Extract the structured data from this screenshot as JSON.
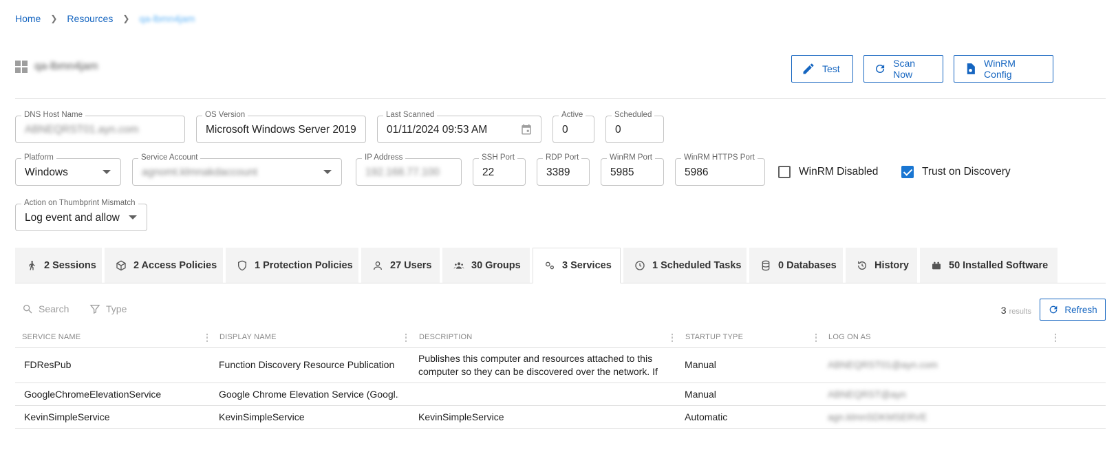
{
  "breadcrumb": {
    "home": "Home",
    "resources": "Resources",
    "current": "qa-lbmn4jam"
  },
  "header": {
    "title": "qa-lbmn4jam",
    "buttons": {
      "test": "Test",
      "scan_now": "Scan Now",
      "winrm_config": "WinRM Config"
    }
  },
  "fields": {
    "dns_host_name": {
      "label": "DNS Host Name",
      "value": "ABNEQRST01.ayn.com"
    },
    "os_version": {
      "label": "OS Version",
      "value": "Microsoft Windows Server 2019"
    },
    "last_scanned": {
      "label": "Last Scanned",
      "value": "01/11/2024 09:53 AM"
    },
    "active": {
      "label": "Active",
      "value": "0"
    },
    "scheduled": {
      "label": "Scheduled",
      "value": "0"
    },
    "platform": {
      "label": "Platform",
      "value": "Windows"
    },
    "service_account": {
      "label": "Service Account",
      "value": "agnomt.klmnakdaccount"
    },
    "ip_address": {
      "label": "IP Address",
      "value": "192.168.77.100"
    },
    "ssh_port": {
      "label": "SSH Port",
      "value": "22"
    },
    "rdp_port": {
      "label": "RDP Port",
      "value": "3389"
    },
    "winrm_port": {
      "label": "WinRM Port",
      "value": "5985"
    },
    "winrm_https_port": {
      "label": "WinRM HTTPS Port",
      "value": "5986"
    },
    "thumbprint_action": {
      "label": "Action on Thumbprint Mismatch",
      "value": "Log event and allow"
    }
  },
  "checkboxes": {
    "winrm_disabled": {
      "label": "WinRM Disabled",
      "checked": false
    },
    "trust_on_discovery": {
      "label": "Trust on Discovery",
      "checked": true
    }
  },
  "tabs": [
    {
      "label": "2 Sessions",
      "icon": "walking-person-icon"
    },
    {
      "label": "2 Access Policies",
      "icon": "cube-icon"
    },
    {
      "label": "1 Protection Policies",
      "icon": "shield-icon"
    },
    {
      "label": "27 Users",
      "icon": "user-icon"
    },
    {
      "label": "30 Groups",
      "icon": "group-icon"
    },
    {
      "label": "3 Services",
      "icon": "gears-icon",
      "active": true
    },
    {
      "label": "1 Scheduled Tasks",
      "icon": "clock-icon"
    },
    {
      "label": "0 Databases",
      "icon": "database-icon"
    },
    {
      "label": "History",
      "icon": "history-icon"
    },
    {
      "label": "50 Installed Software",
      "icon": "software-icon"
    }
  ],
  "toolbar": {
    "search": "Search",
    "type": "Type",
    "results_count": "3",
    "results_label": "results",
    "refresh": "Refresh"
  },
  "table": {
    "columns": [
      "SERVICE NAME",
      "DISPLAY NAME",
      "DESCRIPTION",
      "STARTUP TYPE",
      "LOG ON AS"
    ],
    "rows": [
      {
        "service_name": "FDResPub",
        "display_name": "Function Discovery Resource Publication",
        "description": "Publishes this computer and resources attached to this computer so they can be discovered over the network.  If ...",
        "startup_type": "Manual",
        "log_on_as": "ABNEQRST01@ayn.com"
      },
      {
        "service_name": "GoogleChromeElevationService",
        "display_name": "Google Chrome Elevation Service (Googl...",
        "description": "",
        "startup_type": "Manual",
        "log_on_as": "ABNEQRST@ayn"
      },
      {
        "service_name": "KevinSimpleService",
        "display_name": "KevinSimpleService",
        "description": "KevinSimpleService",
        "startup_type": "Automatic",
        "log_on_as": "agn.klmnSDKMSERVE"
      }
    ]
  },
  "colors": {
    "accent": "#1565c0",
    "checkbox": "#1976d2",
    "border": "#e0e0e0"
  }
}
